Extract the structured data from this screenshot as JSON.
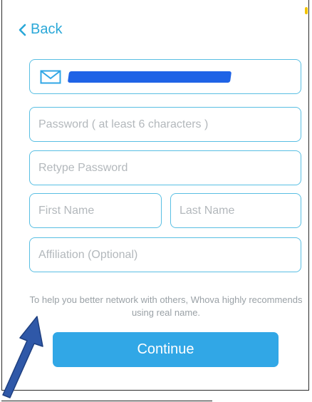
{
  "nav": {
    "back_label": "Back"
  },
  "form": {
    "email_icon": "mail-icon",
    "password_placeholder": "Password ( at least 6 characters )",
    "retype_placeholder": "Retype Password",
    "first_name_placeholder": "First Name",
    "last_name_placeholder": "Last Name",
    "affiliation_placeholder": "Affiliation (Optional)"
  },
  "hint": "To help you better network with others, Whova highly recommends using real name.",
  "continue_label": "Continue",
  "colors": {
    "accent": "#2aa8d8",
    "field_border": "#59bfe3",
    "button": "#31a7e6",
    "redaction": "#1f63e6",
    "annotation_arrow": "#2f58a8"
  }
}
